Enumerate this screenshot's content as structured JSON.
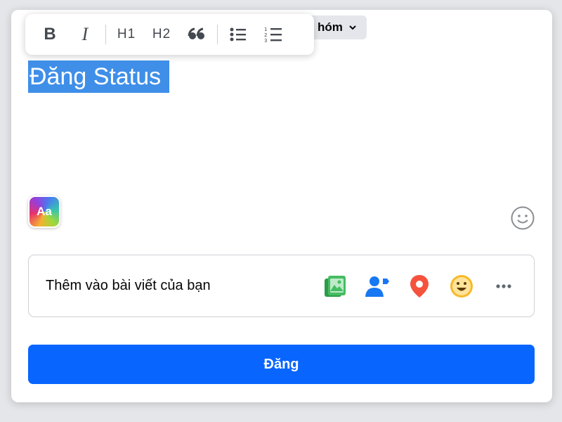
{
  "audience": {
    "label": "hóm"
  },
  "toolbar": {
    "bold": "B",
    "italic": "I",
    "h1": "H1",
    "h2": "H2"
  },
  "composer": {
    "text": "Đăng Status",
    "aa_label": "Aa"
  },
  "add_to_post": {
    "label": "Thêm vào bài viết của bạn",
    "icons": [
      "photo-video-icon",
      "tag-people-icon",
      "check-in-icon",
      "feeling-icon",
      "more-icon"
    ]
  },
  "post_button": {
    "label": "Đăng"
  },
  "colors": {
    "primary": "#0866ff",
    "selection": "#3f8fe8",
    "photo": "#45bd62",
    "tag": "#1877f2",
    "location": "#f5533d",
    "feeling": "#f7b928"
  }
}
